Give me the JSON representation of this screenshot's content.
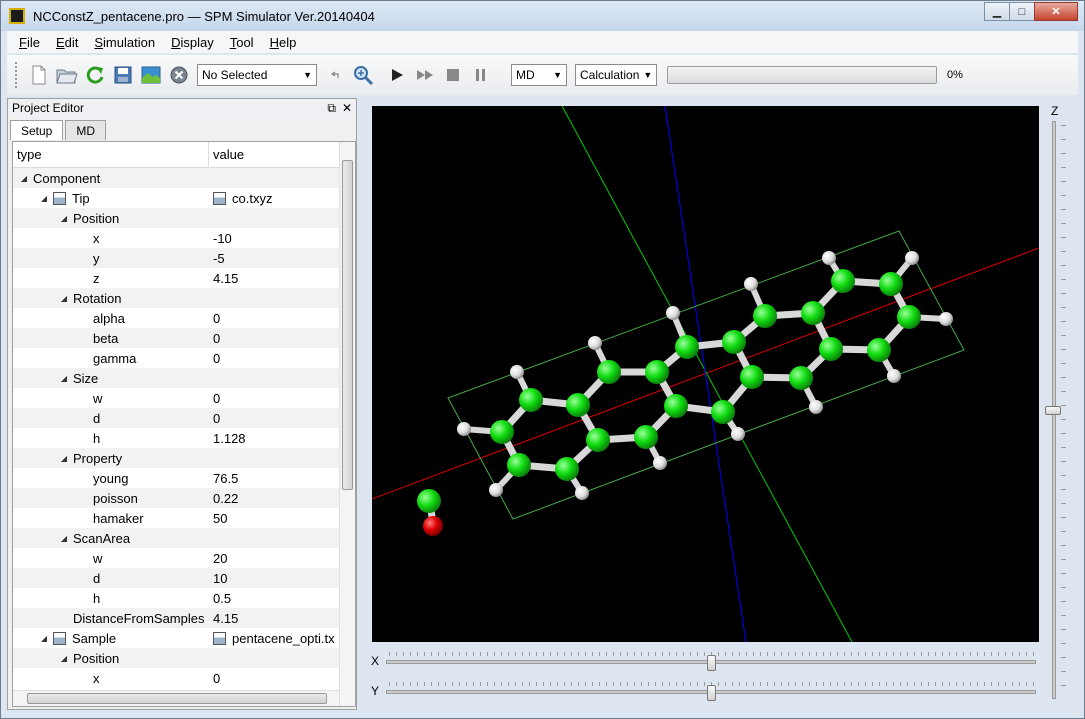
{
  "window": {
    "title": "NCConstZ_pentacene.pro — SPM Simulator Ver.20140404",
    "controls": {
      "minimize": "▁",
      "maximize": "□",
      "close": "✕"
    }
  },
  "menu": [
    {
      "label": "File",
      "accel": "F"
    },
    {
      "label": "Edit",
      "accel": "E"
    },
    {
      "label": "Simulation",
      "accel": "S"
    },
    {
      "label": "Display",
      "accel": "D"
    },
    {
      "label": "Tool",
      "accel": "T"
    },
    {
      "label": "Help",
      "accel": "H"
    }
  ],
  "toolbar": {
    "icons": [
      "new-file-icon",
      "open-folder-icon",
      "reload-icon",
      "save-icon",
      "image-icon",
      "close-circle-icon"
    ],
    "selection_combo": "No Selected",
    "mode_combo": "MD",
    "calc_combo": "Calculation",
    "progress": 0,
    "progress_label": "0%"
  },
  "project_editor": {
    "title": "Project Editor",
    "float_icon": "⧉",
    "close_icon": "✕",
    "tabs": [
      "Setup",
      "MD"
    ],
    "active_tab": "Setup",
    "columns": {
      "type": "type",
      "value": "value"
    },
    "rows": [
      {
        "level": 0,
        "expander": "◢",
        "label": "Component",
        "value": ""
      },
      {
        "level": 1,
        "expander": "◢",
        "icon": true,
        "label": "Tip",
        "value": "co.txyz",
        "value_icon": true
      },
      {
        "level": 2,
        "expander": "◢",
        "label": "Position",
        "value": ""
      },
      {
        "level": 3,
        "label": "x",
        "value": "-10"
      },
      {
        "level": 3,
        "label": "y",
        "value": "-5"
      },
      {
        "level": 3,
        "label": "z",
        "value": "4.15"
      },
      {
        "level": 2,
        "expander": "◢",
        "label": "Rotation",
        "value": ""
      },
      {
        "level": 3,
        "label": "alpha",
        "value": "0"
      },
      {
        "level": 3,
        "label": "beta",
        "value": "0"
      },
      {
        "level": 3,
        "label": "gamma",
        "value": "0"
      },
      {
        "level": 2,
        "expander": "◢",
        "label": "Size",
        "value": ""
      },
      {
        "level": 3,
        "label": "w",
        "value": "0"
      },
      {
        "level": 3,
        "label": "d",
        "value": "0"
      },
      {
        "level": 3,
        "label": "h",
        "value": "1.128"
      },
      {
        "level": 2,
        "expander": "◢",
        "label": "Property",
        "value": ""
      },
      {
        "level": 3,
        "label": "young",
        "value": "76.5"
      },
      {
        "level": 3,
        "label": "poisson",
        "value": "0.22"
      },
      {
        "level": 3,
        "label": "hamaker",
        "value": "50"
      },
      {
        "level": 2,
        "expander": "◢",
        "label": "ScanArea",
        "value": ""
      },
      {
        "level": 3,
        "label": "w",
        "value": "20"
      },
      {
        "level": 3,
        "label": "d",
        "value": "10"
      },
      {
        "level": 3,
        "label": "h",
        "value": "0.5"
      },
      {
        "level": 2,
        "label": "DistanceFromSamples",
        "value": "4.15"
      },
      {
        "level": 1,
        "expander": "◢",
        "icon": true,
        "label": "Sample",
        "value": "pentacene_opti.tx",
        "value_icon": true
      },
      {
        "level": 2,
        "expander": "◢",
        "label": "Position",
        "value": ""
      },
      {
        "level": 3,
        "label": "x",
        "value": "0"
      }
    ]
  },
  "sliders": {
    "x": {
      "label": "X",
      "value": 0.5
    },
    "y": {
      "label": "Y",
      "value": 0.5
    },
    "z": {
      "label": "Z",
      "value": 0.5
    }
  },
  "colors": {
    "carbon": "#11dd11",
    "hydrogen": "#dddddd",
    "oxygen": "#dd0000",
    "bond": "#d8d8d8",
    "axis_x": "#dd0000",
    "axis_y": "#00cc00",
    "axis_z": "#0000ff",
    "box": "#44aa44"
  }
}
